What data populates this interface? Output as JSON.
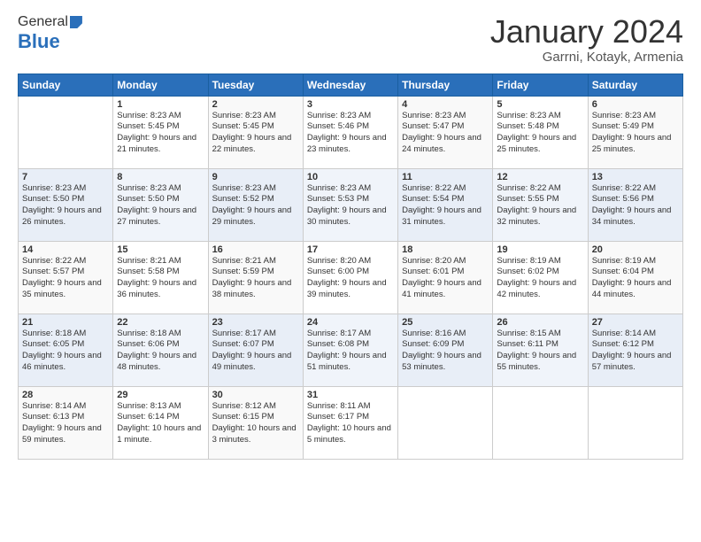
{
  "header": {
    "logo_general": "General",
    "logo_blue": "Blue",
    "title": "January 2024",
    "subtitle": "Garrni, Kotayk, Armenia"
  },
  "weekdays": [
    "Sunday",
    "Monday",
    "Tuesday",
    "Wednesday",
    "Thursday",
    "Friday",
    "Saturday"
  ],
  "weeks": [
    [
      {
        "day": "",
        "sunrise": "",
        "sunset": "",
        "daylight": ""
      },
      {
        "day": "1",
        "sunrise": "Sunrise: 8:23 AM",
        "sunset": "Sunset: 5:45 PM",
        "daylight": "Daylight: 9 hours and 21 minutes."
      },
      {
        "day": "2",
        "sunrise": "Sunrise: 8:23 AM",
        "sunset": "Sunset: 5:45 PM",
        "daylight": "Daylight: 9 hours and 22 minutes."
      },
      {
        "day": "3",
        "sunrise": "Sunrise: 8:23 AM",
        "sunset": "Sunset: 5:46 PM",
        "daylight": "Daylight: 9 hours and 23 minutes."
      },
      {
        "day": "4",
        "sunrise": "Sunrise: 8:23 AM",
        "sunset": "Sunset: 5:47 PM",
        "daylight": "Daylight: 9 hours and 24 minutes."
      },
      {
        "day": "5",
        "sunrise": "Sunrise: 8:23 AM",
        "sunset": "Sunset: 5:48 PM",
        "daylight": "Daylight: 9 hours and 25 minutes."
      },
      {
        "day": "6",
        "sunrise": "Sunrise: 8:23 AM",
        "sunset": "Sunset: 5:49 PM",
        "daylight": "Daylight: 9 hours and 25 minutes."
      }
    ],
    [
      {
        "day": "7",
        "sunrise": "",
        "sunset": "",
        "daylight": ""
      },
      {
        "day": "8",
        "sunrise": "Sunrise: 8:23 AM",
        "sunset": "Sunset: 5:50 PM",
        "daylight": "Daylight: 9 hours and 27 minutes."
      },
      {
        "day": "9",
        "sunrise": "Sunrise: 8:23 AM",
        "sunset": "Sunset: 5:52 PM",
        "daylight": "Daylight: 9 hours and 29 minutes."
      },
      {
        "day": "10",
        "sunrise": "Sunrise: 8:23 AM",
        "sunset": "Sunset: 5:53 PM",
        "daylight": "Daylight: 9 hours and 30 minutes."
      },
      {
        "day": "11",
        "sunrise": "Sunrise: 8:22 AM",
        "sunset": "Sunset: 5:54 PM",
        "daylight": "Daylight: 9 hours and 31 minutes."
      },
      {
        "day": "12",
        "sunrise": "Sunrise: 8:22 AM",
        "sunset": "Sunset: 5:55 PM",
        "daylight": "Daylight: 9 hours and 32 minutes."
      },
      {
        "day": "13",
        "sunrise": "Sunrise: 8:22 AM",
        "sunset": "Sunset: 5:56 PM",
        "daylight": "Daylight: 9 hours and 34 minutes."
      }
    ],
    [
      {
        "day": "14",
        "sunrise": "",
        "sunset": "",
        "daylight": ""
      },
      {
        "day": "15",
        "sunrise": "Sunrise: 8:21 AM",
        "sunset": "Sunset: 5:58 PM",
        "daylight": "Daylight: 9 hours and 36 minutes."
      },
      {
        "day": "16",
        "sunrise": "Sunrise: 8:21 AM",
        "sunset": "Sunset: 5:59 PM",
        "daylight": "Daylight: 9 hours and 38 minutes."
      },
      {
        "day": "17",
        "sunrise": "Sunrise: 8:20 AM",
        "sunset": "Sunset: 6:00 PM",
        "daylight": "Daylight: 9 hours and 39 minutes."
      },
      {
        "day": "18",
        "sunrise": "Sunrise: 8:20 AM",
        "sunset": "Sunset: 6:01 PM",
        "daylight": "Daylight: 9 hours and 41 minutes."
      },
      {
        "day": "19",
        "sunrise": "Sunrise: 8:19 AM",
        "sunset": "Sunset: 6:02 PM",
        "daylight": "Daylight: 9 hours and 42 minutes."
      },
      {
        "day": "20",
        "sunrise": "Sunrise: 8:19 AM",
        "sunset": "Sunset: 6:04 PM",
        "daylight": "Daylight: 9 hours and 44 minutes."
      }
    ],
    [
      {
        "day": "21",
        "sunrise": "",
        "sunset": "",
        "daylight": ""
      },
      {
        "day": "22",
        "sunrise": "Sunrise: 8:18 AM",
        "sunset": "Sunset: 6:06 PM",
        "daylight": "Daylight: 9 hours and 48 minutes."
      },
      {
        "day": "23",
        "sunrise": "Sunrise: 8:17 AM",
        "sunset": "Sunset: 6:07 PM",
        "daylight": "Daylight: 9 hours and 49 minutes."
      },
      {
        "day": "24",
        "sunrise": "Sunrise: 8:17 AM",
        "sunset": "Sunset: 6:08 PM",
        "daylight": "Daylight: 9 hours and 51 minutes."
      },
      {
        "day": "25",
        "sunrise": "Sunrise: 8:16 AM",
        "sunset": "Sunset: 6:09 PM",
        "daylight": "Daylight: 9 hours and 53 minutes."
      },
      {
        "day": "26",
        "sunrise": "Sunrise: 8:15 AM",
        "sunset": "Sunset: 6:11 PM",
        "daylight": "Daylight: 9 hours and 55 minutes."
      },
      {
        "day": "27",
        "sunrise": "Sunrise: 8:14 AM",
        "sunset": "Sunset: 6:12 PM",
        "daylight": "Daylight: 9 hours and 57 minutes."
      }
    ],
    [
      {
        "day": "28",
        "sunrise": "Sunrise: 8:14 AM",
        "sunset": "Sunset: 6:13 PM",
        "daylight": "Daylight: 9 hours and 59 minutes."
      },
      {
        "day": "29",
        "sunrise": "Sunrise: 8:13 AM",
        "sunset": "Sunset: 6:14 PM",
        "daylight": "Daylight: 10 hours and 1 minute."
      },
      {
        "day": "30",
        "sunrise": "Sunrise: 8:12 AM",
        "sunset": "Sunset: 6:15 PM",
        "daylight": "Daylight: 10 hours and 3 minutes."
      },
      {
        "day": "31",
        "sunrise": "Sunrise: 8:11 AM",
        "sunset": "Sunset: 6:17 PM",
        "daylight": "Daylight: 10 hours and 5 minutes."
      },
      {
        "day": "",
        "sunrise": "",
        "sunset": "",
        "daylight": ""
      },
      {
        "day": "",
        "sunrise": "",
        "sunset": "",
        "daylight": ""
      },
      {
        "day": "",
        "sunrise": "",
        "sunset": "",
        "daylight": ""
      }
    ]
  ],
  "week1_day7_info": "Sunrise: 8:23 AM\nSunset: 5:50 PM\nDaylight: 9 hours and 26 minutes.",
  "week2_day14_info": "Sunrise: 8:22 AM\nSunset: 5:57 PM\nDaylight: 9 hours and 35 minutes.",
  "week3_day21_info": "Sunrise: 8:18 AM\nSunset: 6:05 PM\nDaylight: 9 hours and 46 minutes."
}
